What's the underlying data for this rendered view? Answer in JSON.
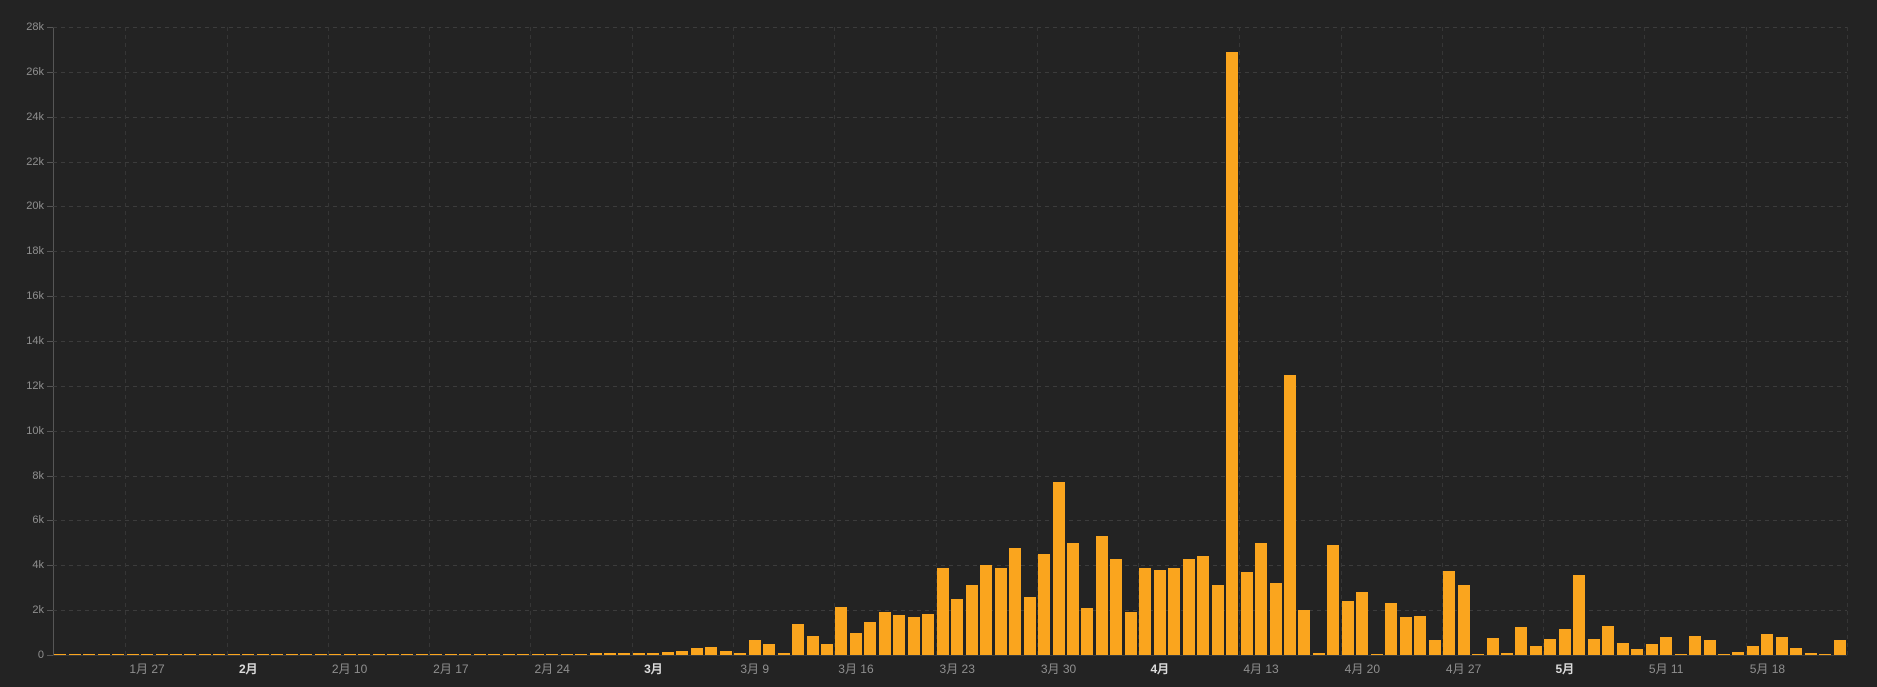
{
  "chart_data": {
    "type": "bar",
    "title": "",
    "xlabel": "",
    "ylabel": "",
    "ylim": [
      0,
      28000
    ],
    "y_step": 2000,
    "grid": true,
    "legend": null,
    "y_tick_labels": [
      "0",
      "2k",
      "4k",
      "6k",
      "8k",
      "10k",
      "12k",
      "14k",
      "16k",
      "18k",
      "20k",
      "22k",
      "24k",
      "26k",
      "28k"
    ],
    "x_tick_labels": [
      {
        "index": 6,
        "label": "1月 27",
        "month_start": false
      },
      {
        "index": 13,
        "label": "2月",
        "month_start": true
      },
      {
        "index": 20,
        "label": "2月 10",
        "month_start": false
      },
      {
        "index": 27,
        "label": "2月 17",
        "month_start": false
      },
      {
        "index": 34,
        "label": "2月 24",
        "month_start": false
      },
      {
        "index": 41,
        "label": "3月",
        "month_start": true
      },
      {
        "index": 48,
        "label": "3月 9",
        "month_start": false
      },
      {
        "index": 55,
        "label": "3月 16",
        "month_start": false
      },
      {
        "index": 62,
        "label": "3月 23",
        "month_start": false
      },
      {
        "index": 69,
        "label": "3月 30",
        "month_start": false
      },
      {
        "index": 76,
        "label": "4月",
        "month_start": true
      },
      {
        "index": 83,
        "label": "4月 13",
        "month_start": false
      },
      {
        "index": 90,
        "label": "4月 20",
        "month_start": false
      },
      {
        "index": 97,
        "label": "4月 27",
        "month_start": false
      },
      {
        "index": 104,
        "label": "5月",
        "month_start": true
      },
      {
        "index": 111,
        "label": "5月 11",
        "month_start": false
      },
      {
        "index": 118,
        "label": "5月 18",
        "month_start": false
      }
    ],
    "week_boundary_indices": [
      5,
      12,
      19,
      26,
      33,
      40,
      47,
      54,
      61,
      68,
      75,
      82,
      89,
      96,
      103,
      110,
      117,
      124
    ],
    "x_dates": [
      "1月21",
      "1月22",
      "1月23",
      "1月24",
      "1月25",
      "1月26",
      "1月27",
      "1月28",
      "1月29",
      "1月30",
      "1月31",
      "2月1",
      "2月2",
      "2月3",
      "2月4",
      "2月5",
      "2月6",
      "2月7",
      "2月8",
      "2月9",
      "2月10",
      "2月11",
      "2月12",
      "2月13",
      "2月14",
      "2月15",
      "2月16",
      "2月17",
      "2月18",
      "2月19",
      "2月20",
      "2月21",
      "2月22",
      "2月23",
      "2月24",
      "2月25",
      "2月26",
      "2月27",
      "2月28",
      "2月29",
      "3月1",
      "3月2",
      "3月3",
      "3月4",
      "3月5",
      "3月6",
      "3月7",
      "3月8",
      "3月9",
      "3月10",
      "3月11",
      "3月12",
      "3月13",
      "3月14",
      "3月15",
      "3月16",
      "3月17",
      "3月18",
      "3月19",
      "3月20",
      "3月21",
      "3月22",
      "3月23",
      "3月24",
      "3月25",
      "3月26",
      "3月27",
      "3月28",
      "3月29",
      "3月30",
      "3月31",
      "4月1",
      "4月2",
      "4月3",
      "4月4",
      "4月5",
      "4月6",
      "4月7",
      "4月8",
      "4月9",
      "4月10",
      "4月11",
      "4月12",
      "4月13",
      "4月14",
      "4月15",
      "4月16",
      "4月17",
      "4月18",
      "4月19",
      "4月20",
      "4月21",
      "4月22",
      "4月23",
      "4月24",
      "4月25",
      "4月26",
      "4月27",
      "4月28",
      "4月29",
      "4月30",
      "5月1",
      "5月2",
      "5月3",
      "5月4",
      "5月5",
      "5月6",
      "5月7",
      "5月8",
      "5月9",
      "5月10",
      "5月11",
      "5月12",
      "5月13",
      "5月14",
      "5月15",
      "5月16",
      "5月17",
      "5月18",
      "5月19",
      "5月20",
      "5月21",
      "5月22",
      "5月23"
    ],
    "values": [
      30,
      25,
      30,
      35,
      30,
      25,
      40,
      35,
      30,
      35,
      30,
      25,
      30,
      35,
      30,
      35,
      30,
      35,
      25,
      30,
      40,
      35,
      30,
      35,
      30,
      25,
      30,
      40,
      35,
      30,
      35,
      40,
      30,
      35,
      45,
      50,
      60,
      80,
      90,
      95,
      100,
      110,
      150,
      180,
      330,
      370,
      180,
      90,
      650,
      500,
      80,
      1400,
      850,
      500,
      2150,
      1000,
      1450,
      1900,
      1800,
      1700,
      1850,
      3900,
      2500,
      3100,
      4000,
      3900,
      4750,
      2600,
      4500,
      7700,
      5000,
      2100,
      5300,
      4300,
      1900,
      3900,
      3800,
      3900,
      4300,
      4400,
      3100,
      26900,
      3700,
      5000,
      3200,
      12500,
      2000,
      70,
      4900,
      2400,
      2800,
      30,
      2300,
      1700,
      1750,
      650,
      3750,
      3100,
      40,
      750,
      80,
      1250,
      400,
      700,
      1150,
      3550,
      700,
      1300,
      550,
      270,
      500,
      800,
      50,
      850,
      650,
      30,
      120,
      400,
      950,
      800,
      300,
      80,
      50,
      650
    ]
  },
  "colors": {
    "background": "#232323",
    "bar": "#faa51e",
    "grid_h": "#3c3c3c",
    "grid_v": "#363636",
    "axis": "#565656",
    "x_axis_line": "#3a3a3a",
    "tick_label": "#8f8f8f",
    "month_label": "#dcdcdc"
  }
}
